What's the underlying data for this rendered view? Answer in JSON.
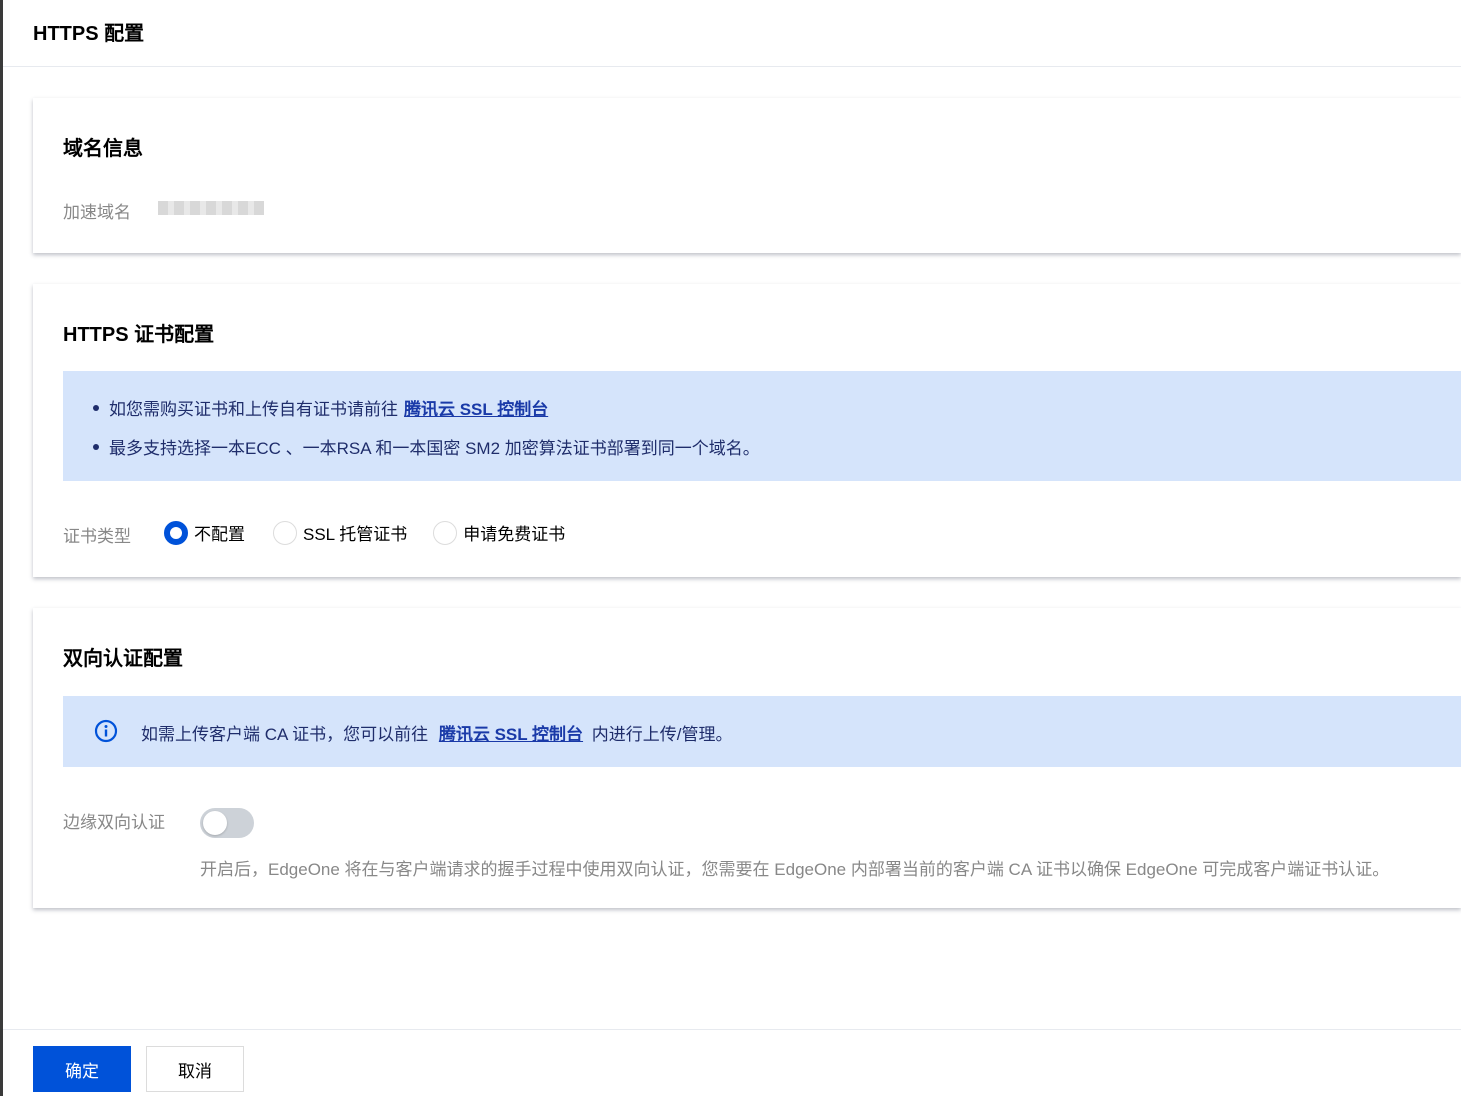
{
  "header": {
    "title": "HTTPS 配置"
  },
  "domain_info": {
    "title": "域名信息",
    "accel_domain_label": "加速域名"
  },
  "https_cert": {
    "title": "HTTPS 证书配置",
    "notice": {
      "line1_text": "如您需购买证书和上传自有证书请前往",
      "line1_link": "腾讯云 SSL 控制台",
      "line2_text": "最多支持选择一本ECC 、一本RSA 和一本国密 SM2 加密算法证书部署到同一个域名。"
    },
    "cert_type_label": "证书类型",
    "options": [
      {
        "label": "不配置",
        "selected": true
      },
      {
        "label": "SSL 托管证书",
        "selected": false
      },
      {
        "label": "申请免费证书",
        "selected": false
      }
    ]
  },
  "mutual_auth": {
    "title": "双向认证配置",
    "info_prefix": "如需上传客户端 CA 证书，您可以前往",
    "info_link": "腾讯云 SSL 控制台",
    "info_suffix": "内进行上传/管理。",
    "edge_auth_label": "边缘双向认证",
    "toggle_on": false,
    "help_text": "开启后，EdgeOne 将在与客户端请求的握手过程中使用双向认证，您需要在 EdgeOne 内部署当前的客户端 CA 证书以确保 EdgeOne 可完成客户端证书认证。"
  },
  "footer": {
    "confirm_label": "确定",
    "cancel_label": "取消"
  },
  "colors": {
    "primary": "#0052d9",
    "notice_bg": "#d5e4fb",
    "notice_text": "#1f2d6b",
    "link": "#1a3aa8"
  }
}
